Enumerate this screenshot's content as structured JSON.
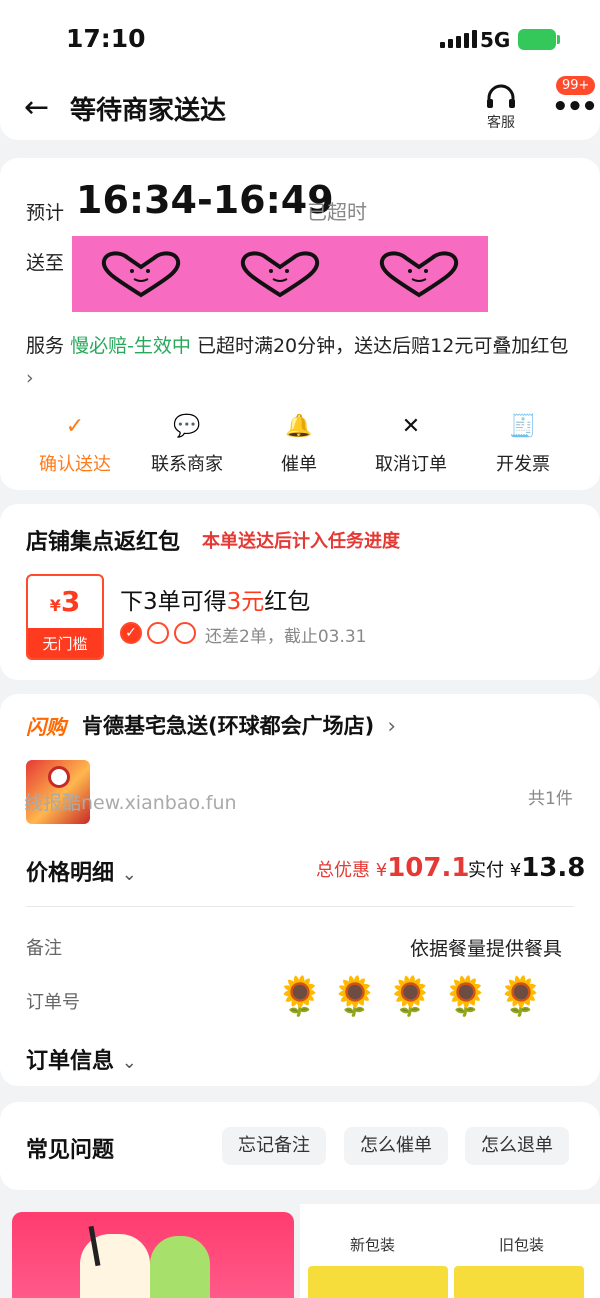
{
  "status_bar": {
    "time": "17:10",
    "network": "5G"
  },
  "nav": {
    "title": "等待商家送达",
    "customer_service": "客服",
    "badge": "99+"
  },
  "delivery": {
    "eta_label": "预计",
    "eta_time": "16:34-16:49",
    "overtime": "已超时",
    "address_label": "送至",
    "service_label": "服务",
    "service_name": "慢必赔-生效中",
    "service_desc": "已超时满20分钟，送达后赔12元可叠加红包",
    "arrow": "›"
  },
  "actions": [
    {
      "label": "确认送达",
      "icon": "✓"
    },
    {
      "label": "联系商家",
      "icon": "💬"
    },
    {
      "label": "催单",
      "icon": "🔔"
    },
    {
      "label": "取消订单",
      "icon": "✕"
    },
    {
      "label": "开发票",
      "icon": "🧾"
    }
  ],
  "reward": {
    "title": "店铺集点返红包",
    "subtitle": "本单送达后计入任务进度",
    "coupon_currency": "¥",
    "coupon_amount": "3",
    "coupon_note": "无门槛",
    "task_prefix": "下3单可得",
    "task_amount": "3元",
    "task_suffix": "红包",
    "progress_done": 1,
    "progress_total": 3,
    "check": "✓",
    "task_note": "还差2单，截止03.31"
  },
  "order": {
    "flash_tag": "闪购",
    "shop_name": "肯德基宅急送(环球都会广场店)",
    "shop_arrow": "›",
    "watermark": "线报酷new.xianbao.fun",
    "item_count": "共1件",
    "price_detail": "价格明细",
    "chevron": "⌄",
    "discount_label": "总优惠",
    "discount_currency": "¥",
    "discount_value": "107.1",
    "paid_label": "实付",
    "paid_currency": "¥",
    "paid_value": "13.8",
    "remark_label": "备注",
    "remark_value": "依据餐量提供餐具",
    "order_no_label": "订单号",
    "order_info": "订单信息"
  },
  "faq": {
    "title": "常见问题",
    "chips": [
      "忘记备注",
      "怎么催单",
      "怎么退单"
    ]
  },
  "promo": {
    "new_pkg": "新包装",
    "old_pkg": "旧包装"
  },
  "colors": {
    "accent_orange": "#ff7a1a",
    "red": "#e53935",
    "green": "#27a85a",
    "pink_block": "#f76cc0"
  }
}
